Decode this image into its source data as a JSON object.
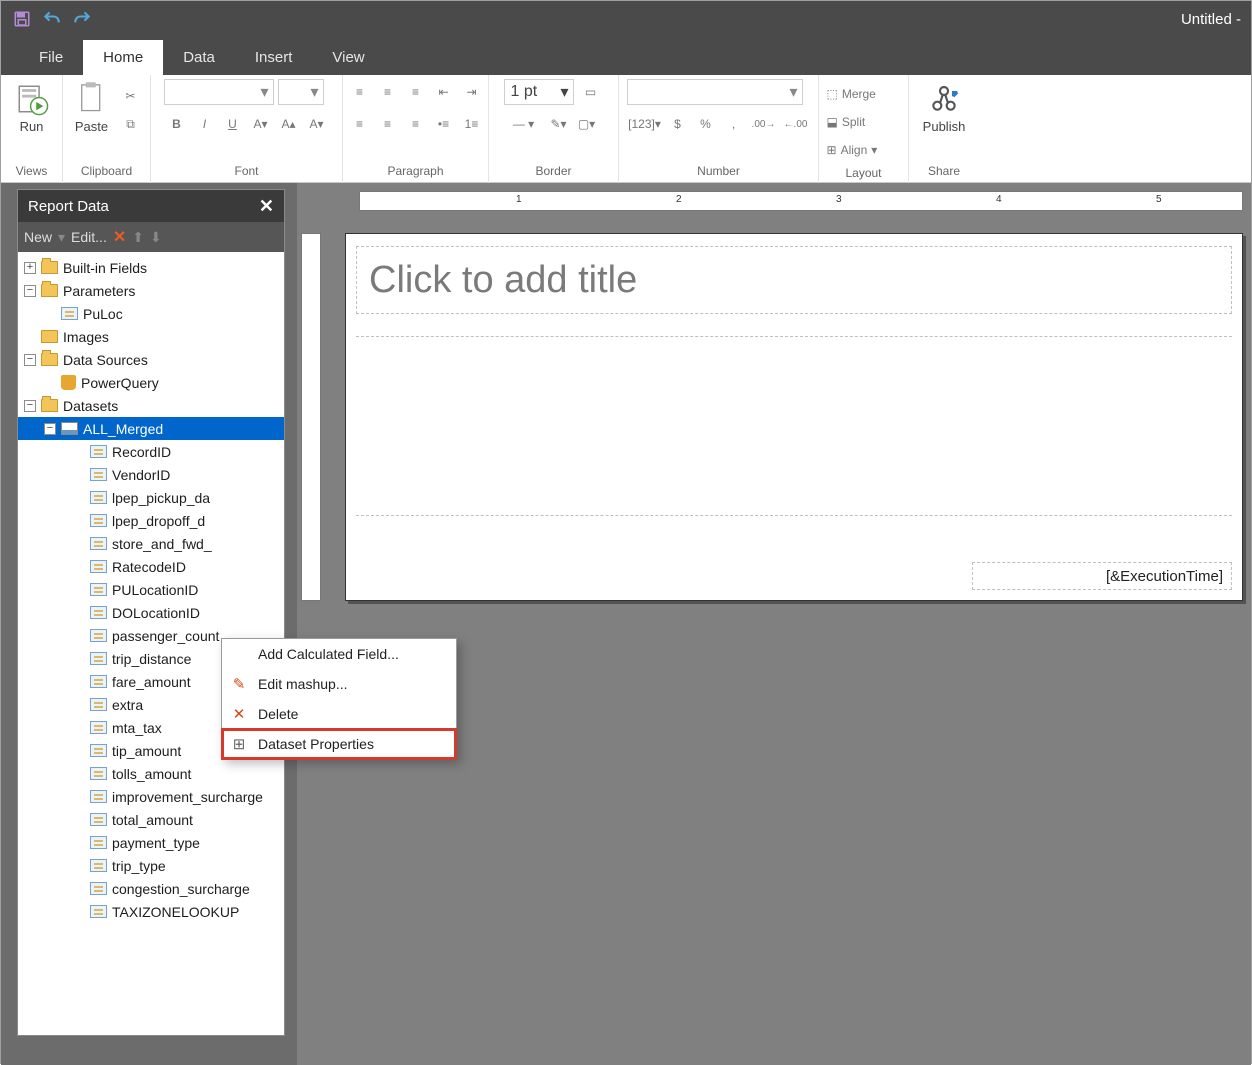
{
  "title": "Untitled -",
  "tabs": {
    "file": "File",
    "home": "Home",
    "data": "Data",
    "insert": "Insert",
    "view": "View"
  },
  "ribbon": {
    "views_label": "Views",
    "run": "Run",
    "clipboard_label": "Clipboard",
    "paste": "Paste",
    "font_label": "Font",
    "paragraph_label": "Paragraph",
    "border_label": "Border",
    "border_pt": "1 pt",
    "number_label": "Number",
    "layout_label": "Layout",
    "merge": "Merge",
    "split": "Split",
    "align": "Align",
    "share_label": "Share",
    "publish": "Publish"
  },
  "panel": {
    "title": "Report Data",
    "new": "New",
    "edit": "Edit...",
    "tree": {
      "builtins": "Built-in Fields",
      "parameters": "Parameters",
      "puloc": "PuLoc",
      "images": "Images",
      "datasources": "Data Sources",
      "powerquery": "PowerQuery",
      "datasets": "Datasets",
      "all_merged": "ALL_Merged",
      "fields": [
        "RecordID",
        "VendorID",
        "lpep_pickup_da",
        "lpep_dropoff_d",
        "store_and_fwd_",
        "RatecodeID",
        "PULocationID",
        "DOLocationID",
        "passenger_count",
        "trip_distance",
        "fare_amount",
        "extra",
        "mta_tax",
        "tip_amount",
        "tolls_amount",
        "improvement_surcharge",
        "total_amount",
        "payment_type",
        "trip_type",
        "congestion_surcharge",
        "TAXIZONELOOKUP"
      ]
    }
  },
  "context_menu": {
    "add_calc": "Add Calculated Field...",
    "edit_mashup": "Edit mashup...",
    "delete": "Delete",
    "dataset_properties": "Dataset Properties"
  },
  "canvas": {
    "title_placeholder": "Click to add title",
    "footer_expr": "[&ExecutionTime]"
  },
  "ruler_numbers": [
    1,
    2,
    3,
    4,
    5
  ]
}
